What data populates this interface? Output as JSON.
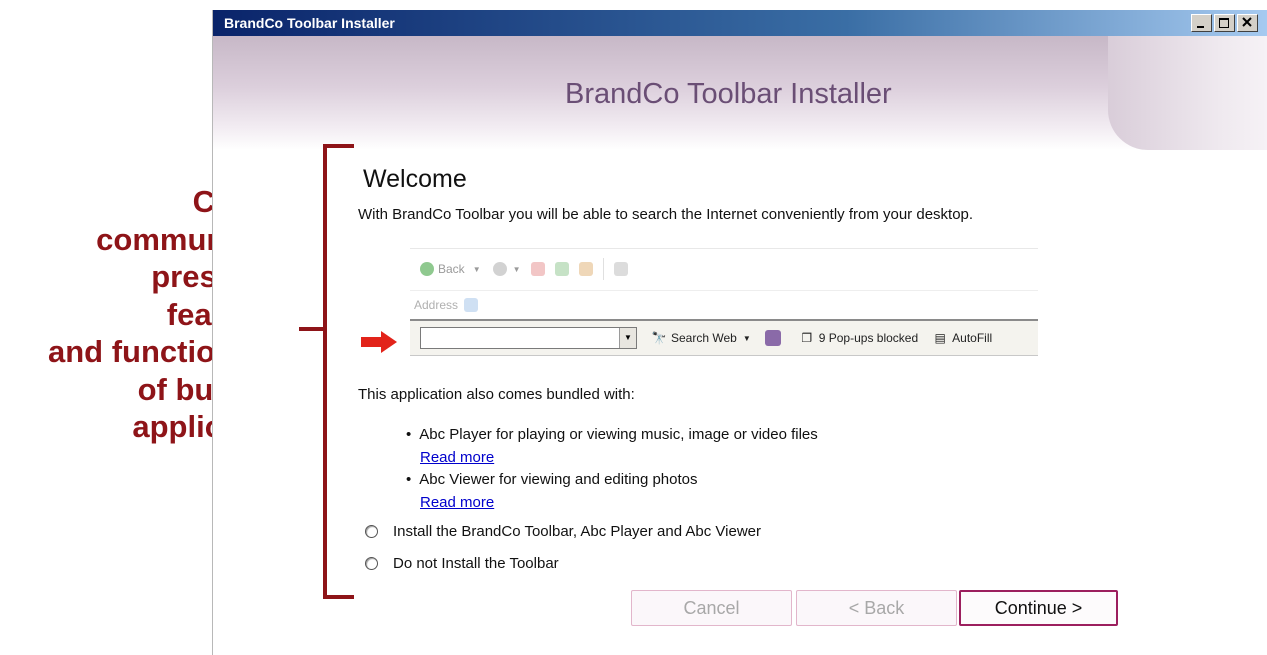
{
  "annotation": {
    "lines": [
      "Clearly",
      "communicate",
      "presence,",
      "features,",
      "and functionality",
      "of bundled",
      "application"
    ],
    "color": "#8e1418"
  },
  "window": {
    "title": "BrandCo Toolbar Installer",
    "controls": [
      "minimize-icon",
      "maximize-icon",
      "close-icon"
    ]
  },
  "banner": {
    "title": "BrandCo Toolbar Installer"
  },
  "welcome": {
    "heading": "Welcome",
    "intro": "With BrandCo Toolbar you will be able to search the Internet conveniently from your desktop."
  },
  "toolbar_preview": {
    "back_label": "Back",
    "address_label": "Address",
    "search_label": "Search Web",
    "popups_label": "9 Pop-ups blocked",
    "autofill_label": "AutoFill"
  },
  "bundled": {
    "intro": "This application also comes bundled with:",
    "items": [
      {
        "text": "Abc Player for playing or viewing music, image or video files",
        "link": "Read more"
      },
      {
        "text": "Abc Viewer for viewing and editing photos",
        "link": "Read more"
      }
    ]
  },
  "options": [
    "Install the BrandCo Toolbar, Abc Player and Abc Viewer",
    "Do not Install the Toolbar"
  ],
  "buttons": {
    "cancel": "Cancel",
    "back": "< Back",
    "continue": "Continue >"
  },
  "colors": {
    "accent": "#9c1f5e",
    "banner_text": "#6a4e75",
    "link": "#0000cc"
  }
}
